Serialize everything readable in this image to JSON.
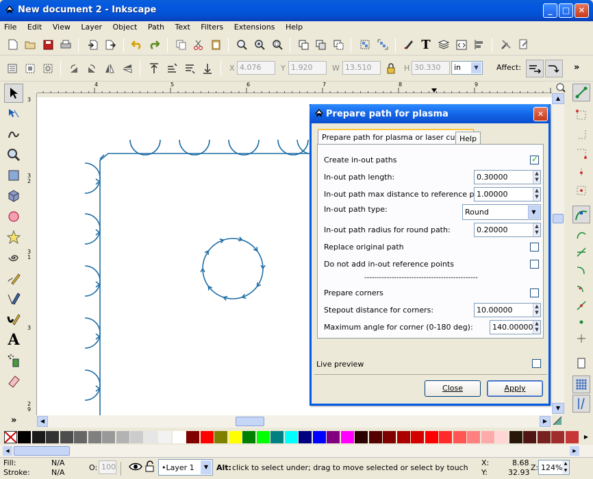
{
  "window": {
    "title": "New document 2 - Inkscape"
  },
  "menu": [
    "File",
    "Edit",
    "View",
    "Layer",
    "Object",
    "Path",
    "Text",
    "Filters",
    "Extensions",
    "Help"
  ],
  "toolbar2": {
    "x_label": "X",
    "x_value": "4.076",
    "y_label": "Y",
    "y_value": "1.920",
    "w_label": "W",
    "w_value": "13.510",
    "h_label": "H",
    "h_value": "30.330",
    "unit": "in",
    "affect_label": "Affect:"
  },
  "ruler": {
    "h_ticks": [
      "4",
      "5",
      "6",
      "7",
      "8",
      "9"
    ],
    "v_ticks": [
      "3",
      "3 2",
      "3 1",
      "3",
      "2 9"
    ]
  },
  "dialog": {
    "title": "Prepare path for plasma",
    "tabs": [
      "Prepare path for plasma or laser cuters",
      "Help"
    ],
    "create_inout": {
      "label": "Create in-out paths",
      "checked": true
    },
    "inout_length": {
      "label": "In-out path length:",
      "value": "0.30000"
    },
    "inout_maxdist": {
      "label": "In-out path max distance to reference point:",
      "value": "1.00000"
    },
    "inout_type": {
      "label": "In-out path type:",
      "value": "Round"
    },
    "inout_radius": {
      "label": "In-out path radius for round path:",
      "value": "0.20000"
    },
    "replace_original": {
      "label": "Replace original path",
      "checked": false
    },
    "no_ref_points": {
      "label": "Do not add in-out reference points",
      "checked": false
    },
    "separator": "----------------------------------------------",
    "prepare_corners": {
      "label": "Prepare corners",
      "checked": false
    },
    "stepout": {
      "label": "Stepout distance for corners:",
      "value": "10.00000"
    },
    "max_angle": {
      "label": "Maximum angle for corner (0-180 deg):",
      "value": "140.00000"
    },
    "live_preview": {
      "label": "Live preview",
      "checked": false
    },
    "close_label": "Close",
    "apply_label": "Apply"
  },
  "status": {
    "fill_label": "Fill:",
    "fill_value": "N/A",
    "stroke_label": "Stroke:",
    "stroke_value": "N/A",
    "opacity_label": "O:",
    "opacity_value": "100",
    "layer": "•Layer 1",
    "message_bold": "Alt:",
    "message": " click to select under; drag to move selected or select by touch",
    "x_label": "X:",
    "x_value": "8.68",
    "y_label": "Y:",
    "y_value": "32.93",
    "zoom_label": "Z:",
    "zoom_value": "124%"
  },
  "colors": {
    "path_stroke": "#1f6ea5",
    "palette": [
      "#000000",
      "#1a1a1a",
      "#333333",
      "#4d4d4d",
      "#666666",
      "#808080",
      "#999999",
      "#b3b3b3",
      "#cccccc",
      "#e6e6e6",
      "#f2f2f2",
      "#ffffff",
      "#800000",
      "#ff0000",
      "#808000",
      "#ffff00",
      "#008000",
      "#00ff00",
      "#008080",
      "#00ffff",
      "#000080",
      "#0000ff",
      "#800080",
      "#ff00ff",
      "#2b0000",
      "#550000",
      "#800000",
      "#aa0000",
      "#d40000",
      "#ff0000",
      "#ff2a2a",
      "#ff5555",
      "#ff8080",
      "#ffaaaa",
      "#ffd5d5",
      "#28170b",
      "#501616",
      "#782121",
      "#a02c2c",
      "#c83737"
    ]
  }
}
